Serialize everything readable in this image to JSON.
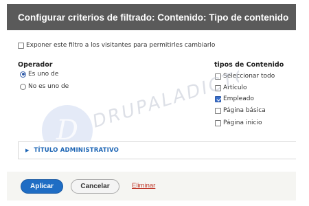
{
  "dialog": {
    "title": "Configurar criterios de filtrado: Contenido: Tipo de contenido"
  },
  "expose": {
    "label": "Exponer este filtro a los visitantes para permitirles cambiarlo",
    "checked": false
  },
  "operator": {
    "title": "Operador",
    "options": [
      {
        "label": "Es uno de",
        "checked": true
      },
      {
        "label": "No es uno de",
        "checked": false
      }
    ]
  },
  "content_types": {
    "title": "tipos de Contenido",
    "options": [
      {
        "label": "Seleccionar todo",
        "checked": false
      },
      {
        "label": "Artículo",
        "checked": false
      },
      {
        "label": "Empleado",
        "checked": true
      },
      {
        "label": "Página básica",
        "checked": false
      },
      {
        "label": "Página inicio",
        "checked": false
      }
    ]
  },
  "admin_section": {
    "label": "TÍTULO ADMINISTRATIVO",
    "icon": "triangle-right-icon"
  },
  "watermark": {
    "text": "DRUPALADICTO",
    "logo_letter": "D"
  },
  "footer": {
    "apply_label": "Aplicar",
    "cancel_label": "Cancelar",
    "delete_label": "Eliminar"
  },
  "colors": {
    "title_bar": "#5a5a5a",
    "primary": "#1f6dc4",
    "link": "#1b64b4",
    "danger": "#c0392b"
  }
}
